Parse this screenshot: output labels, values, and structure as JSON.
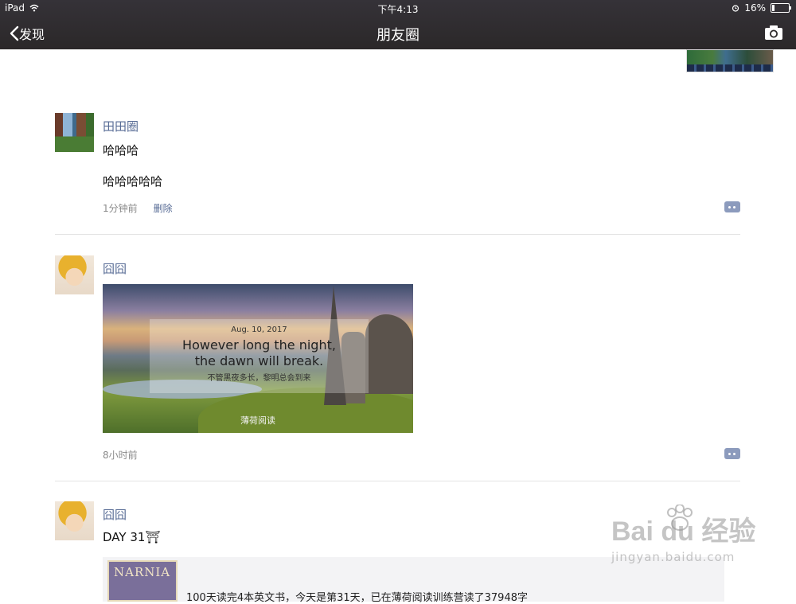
{
  "status_bar": {
    "device": "iPad",
    "time": "下午4:13",
    "battery": "16%",
    "battery_level": 0.16
  },
  "nav": {
    "back_label": "发现",
    "title": "朋友圈"
  },
  "posts": [
    {
      "author": "田田圈",
      "lines": [
        "哈哈哈",
        "哈哈哈哈哈"
      ],
      "time": "1分钟前",
      "delete_label": "删除"
    },
    {
      "author": "囧囧",
      "image": {
        "date": "Aug. 10, 2017",
        "quote_line1": "However long the night,",
        "quote_line2": "the dawn will break.",
        "quote_cn": "不管黑夜多长，黎明总会到来",
        "brand": "薄荷阅读"
      },
      "time": "8小时前"
    },
    {
      "author": "囧囧",
      "text": "DAY 31⛩",
      "link": {
        "book_title": "NARNIA",
        "text": "100天读完4本英文书，今天是第31天，已在薄荷阅读训练营读了37948字"
      }
    }
  ],
  "watermark": {
    "main": "Bai du 经验",
    "sub": "jingyan.baidu.com"
  },
  "colors": {
    "nav_bg": "#2b2829",
    "name_link": "#576b95",
    "meta_gray": "#8a8a8a"
  }
}
